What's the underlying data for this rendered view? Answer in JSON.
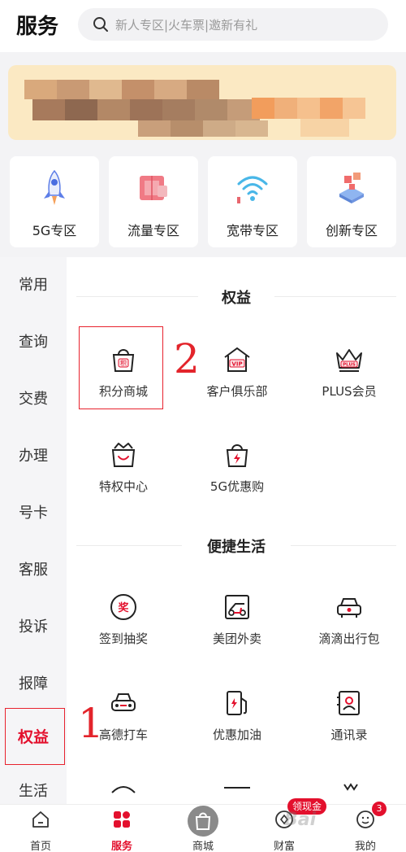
{
  "header": {
    "title": "服务",
    "search_placeholder": "新人专区|火车票|邀新有礼"
  },
  "quick_tiles": [
    {
      "label": "5G专区",
      "icon": "rocket-icon"
    },
    {
      "label": "流量专区",
      "icon": "traffic-box-icon"
    },
    {
      "label": "宽带专区",
      "icon": "wifi-icon"
    },
    {
      "label": "创新专区",
      "icon": "innovation-icon"
    }
  ],
  "sidebar": {
    "items": [
      {
        "label": "常用"
      },
      {
        "label": "查询"
      },
      {
        "label": "交费"
      },
      {
        "label": "办理"
      },
      {
        "label": "号卡"
      },
      {
        "label": "客服"
      },
      {
        "label": "投诉"
      },
      {
        "label": "报障"
      },
      {
        "label": "权益"
      },
      {
        "label": "生活"
      }
    ],
    "active": "权益"
  },
  "sections": [
    {
      "title": "权益",
      "items": [
        {
          "label": "积分商城",
          "icon": "points-bag-icon"
        },
        {
          "label": "客户俱乐部",
          "icon": "vip-house-icon"
        },
        {
          "label": "PLUS会员",
          "icon": "plus-crown-icon"
        },
        {
          "label": "特权中心",
          "icon": "privilege-bag-icon"
        },
        {
          "label": "5G优惠购",
          "icon": "5g-bag-icon"
        }
      ]
    },
    {
      "title": "便捷生活",
      "items": [
        {
          "label": "签到抽奖",
          "icon": "lottery-icon"
        },
        {
          "label": "美团外卖",
          "icon": "delivery-icon"
        },
        {
          "label": "滴滴出行包",
          "icon": "car-icon"
        },
        {
          "label": "高德打车",
          "icon": "taxi-icon"
        },
        {
          "label": "优惠加油",
          "icon": "fuel-icon"
        },
        {
          "label": "通讯录",
          "icon": "contacts-icon"
        }
      ]
    }
  ],
  "annotations": {
    "step1": "1",
    "step2": "2"
  },
  "bottom_nav": {
    "items": [
      {
        "label": "首页",
        "icon": "home-icon"
      },
      {
        "label": "服务",
        "icon": "service-icon"
      },
      {
        "label": "商城",
        "icon": "shopping-bag-icon"
      },
      {
        "label": "财富",
        "icon": "wealth-icon"
      },
      {
        "label": "我的",
        "icon": "profile-icon"
      }
    ],
    "active": "服务",
    "wealth_badge": "领现金",
    "profile_badge": "3",
    "watermark": "Bai"
  },
  "colors": {
    "accent": "#e3102d",
    "annotation": "#e8222e",
    "sidebar_bg": "#f5f5f7",
    "banner_bg": "#fbe9c3"
  }
}
